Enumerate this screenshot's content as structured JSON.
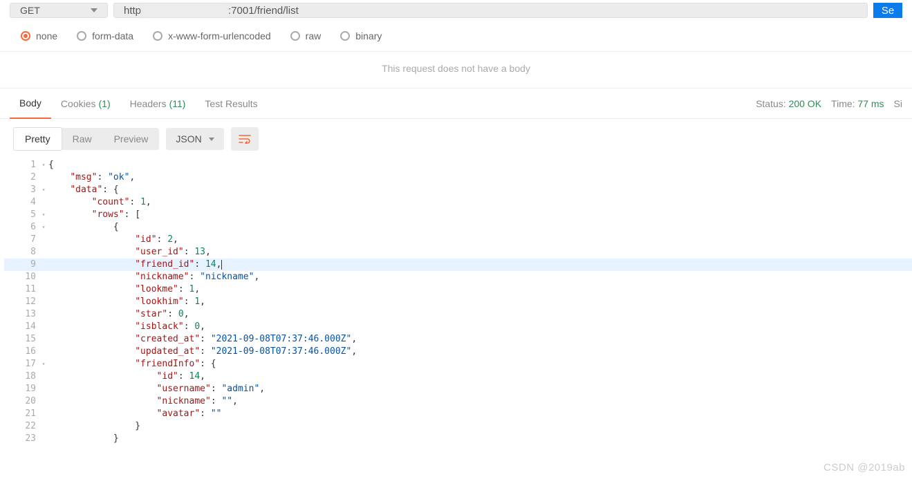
{
  "request": {
    "method": "GET",
    "url_prefix": "http",
    "url_suffix": ":7001/friend/list",
    "send_label": "Se"
  },
  "body_types": {
    "none": "none",
    "form_data": "form-data",
    "urlencoded": "x-www-form-urlencoded",
    "raw": "raw",
    "binary": "binary"
  },
  "nobody_text": "This request does not have a body",
  "tabs": {
    "body": "Body",
    "cookies": "Cookies",
    "cookies_count": "(1)",
    "headers": "Headers",
    "headers_count": "(11)",
    "test_results": "Test Results"
  },
  "status_meta": {
    "status_label": "Status:",
    "status_value": "200 OK",
    "time_label": "Time:",
    "time_value": "77 ms",
    "size_label": "Si"
  },
  "view_toolbar": {
    "pretty": "Pretty",
    "raw": "Raw",
    "preview": "Preview",
    "format": "JSON"
  },
  "code_lines": [
    {
      "n": 1,
      "f": "▾",
      "parts": [
        {
          "t": "{",
          "c": "punc"
        }
      ]
    },
    {
      "n": 2,
      "f": "",
      "parts": [
        {
          "t": "    ",
          "c": ""
        },
        {
          "t": "\"msg\"",
          "c": "key"
        },
        {
          "t": ": ",
          "c": "punc"
        },
        {
          "t": "\"ok\"",
          "c": "str"
        },
        {
          "t": ",",
          "c": "punc"
        }
      ]
    },
    {
      "n": 3,
      "f": "▾",
      "parts": [
        {
          "t": "    ",
          "c": ""
        },
        {
          "t": "\"data\"",
          "c": "key"
        },
        {
          "t": ": {",
          "c": "punc"
        }
      ]
    },
    {
      "n": 4,
      "f": "",
      "parts": [
        {
          "t": "        ",
          "c": ""
        },
        {
          "t": "\"count\"",
          "c": "key"
        },
        {
          "t": ": ",
          "c": "punc"
        },
        {
          "t": "1",
          "c": "num"
        },
        {
          "t": ",",
          "c": "punc"
        }
      ]
    },
    {
      "n": 5,
      "f": "▾",
      "parts": [
        {
          "t": "        ",
          "c": ""
        },
        {
          "t": "\"rows\"",
          "c": "key"
        },
        {
          "t": ": [",
          "c": "punc"
        }
      ]
    },
    {
      "n": 6,
      "f": "▾",
      "parts": [
        {
          "t": "            {",
          "c": "punc"
        }
      ]
    },
    {
      "n": 7,
      "f": "",
      "parts": [
        {
          "t": "                ",
          "c": ""
        },
        {
          "t": "\"id\"",
          "c": "key"
        },
        {
          "t": ": ",
          "c": "punc"
        },
        {
          "t": "2",
          "c": "num"
        },
        {
          "t": ",",
          "c": "punc"
        }
      ]
    },
    {
      "n": 8,
      "f": "",
      "parts": [
        {
          "t": "                ",
          "c": ""
        },
        {
          "t": "\"user_id\"",
          "c": "key"
        },
        {
          "t": ": ",
          "c": "punc"
        },
        {
          "t": "13",
          "c": "num"
        },
        {
          "t": ",",
          "c": "punc"
        }
      ]
    },
    {
      "n": 9,
      "f": "",
      "hl": true,
      "parts": [
        {
          "t": "                ",
          "c": ""
        },
        {
          "t": "\"friend_id\"",
          "c": "key"
        },
        {
          "t": ": ",
          "c": "punc"
        },
        {
          "t": "14",
          "c": "num"
        },
        {
          "t": ",",
          "c": "punc"
        },
        {
          "t": "|",
          "c": "cursor"
        }
      ]
    },
    {
      "n": 10,
      "f": "",
      "parts": [
        {
          "t": "                ",
          "c": ""
        },
        {
          "t": "\"nickname\"",
          "c": "key"
        },
        {
          "t": ": ",
          "c": "punc"
        },
        {
          "t": "\"nickname\"",
          "c": "str"
        },
        {
          "t": ",",
          "c": "punc"
        }
      ]
    },
    {
      "n": 11,
      "f": "",
      "parts": [
        {
          "t": "                ",
          "c": ""
        },
        {
          "t": "\"lookme\"",
          "c": "key"
        },
        {
          "t": ": ",
          "c": "punc"
        },
        {
          "t": "1",
          "c": "num"
        },
        {
          "t": ",",
          "c": "punc"
        }
      ]
    },
    {
      "n": 12,
      "f": "",
      "parts": [
        {
          "t": "                ",
          "c": ""
        },
        {
          "t": "\"lookhim\"",
          "c": "key"
        },
        {
          "t": ": ",
          "c": "punc"
        },
        {
          "t": "1",
          "c": "num"
        },
        {
          "t": ",",
          "c": "punc"
        }
      ]
    },
    {
      "n": 13,
      "f": "",
      "parts": [
        {
          "t": "                ",
          "c": ""
        },
        {
          "t": "\"star\"",
          "c": "key"
        },
        {
          "t": ": ",
          "c": "punc"
        },
        {
          "t": "0",
          "c": "num"
        },
        {
          "t": ",",
          "c": "punc"
        }
      ]
    },
    {
      "n": 14,
      "f": "",
      "parts": [
        {
          "t": "                ",
          "c": ""
        },
        {
          "t": "\"isblack\"",
          "c": "key"
        },
        {
          "t": ": ",
          "c": "punc"
        },
        {
          "t": "0",
          "c": "num"
        },
        {
          "t": ",",
          "c": "punc"
        }
      ]
    },
    {
      "n": 15,
      "f": "",
      "parts": [
        {
          "t": "                ",
          "c": ""
        },
        {
          "t": "\"created_at\"",
          "c": "key"
        },
        {
          "t": ": ",
          "c": "punc"
        },
        {
          "t": "\"2021-09-08T07:37:46.000Z\"",
          "c": "str"
        },
        {
          "t": ",",
          "c": "punc"
        }
      ]
    },
    {
      "n": 16,
      "f": "",
      "parts": [
        {
          "t": "                ",
          "c": ""
        },
        {
          "t": "\"updated_at\"",
          "c": "key"
        },
        {
          "t": ": ",
          "c": "punc"
        },
        {
          "t": "\"2021-09-08T07:37:46.000Z\"",
          "c": "str"
        },
        {
          "t": ",",
          "c": "punc"
        }
      ]
    },
    {
      "n": 17,
      "f": "▾",
      "parts": [
        {
          "t": "                ",
          "c": ""
        },
        {
          "t": "\"friendInfo\"",
          "c": "key"
        },
        {
          "t": ": {",
          "c": "punc"
        }
      ]
    },
    {
      "n": 18,
      "f": "",
      "parts": [
        {
          "t": "                    ",
          "c": ""
        },
        {
          "t": "\"id\"",
          "c": "key"
        },
        {
          "t": ": ",
          "c": "punc"
        },
        {
          "t": "14",
          "c": "num"
        },
        {
          "t": ",",
          "c": "punc"
        }
      ]
    },
    {
      "n": 19,
      "f": "",
      "parts": [
        {
          "t": "                    ",
          "c": ""
        },
        {
          "t": "\"username\"",
          "c": "key"
        },
        {
          "t": ": ",
          "c": "punc"
        },
        {
          "t": "\"admin\"",
          "c": "str"
        },
        {
          "t": ",",
          "c": "punc"
        }
      ]
    },
    {
      "n": 20,
      "f": "",
      "parts": [
        {
          "t": "                    ",
          "c": ""
        },
        {
          "t": "\"nickname\"",
          "c": "key"
        },
        {
          "t": ": ",
          "c": "punc"
        },
        {
          "t": "\"\"",
          "c": "str"
        },
        {
          "t": ",",
          "c": "punc"
        }
      ]
    },
    {
      "n": 21,
      "f": "",
      "parts": [
        {
          "t": "                    ",
          "c": ""
        },
        {
          "t": "\"avatar\"",
          "c": "key"
        },
        {
          "t": ": ",
          "c": "punc"
        },
        {
          "t": "\"\"",
          "c": "str"
        }
      ]
    },
    {
      "n": 22,
      "f": "",
      "parts": [
        {
          "t": "                }",
          "c": "punc"
        }
      ]
    },
    {
      "n": 23,
      "f": "",
      "parts": [
        {
          "t": "            }",
          "c": "punc"
        }
      ]
    }
  ],
  "watermark": "CSDN @2019ab"
}
